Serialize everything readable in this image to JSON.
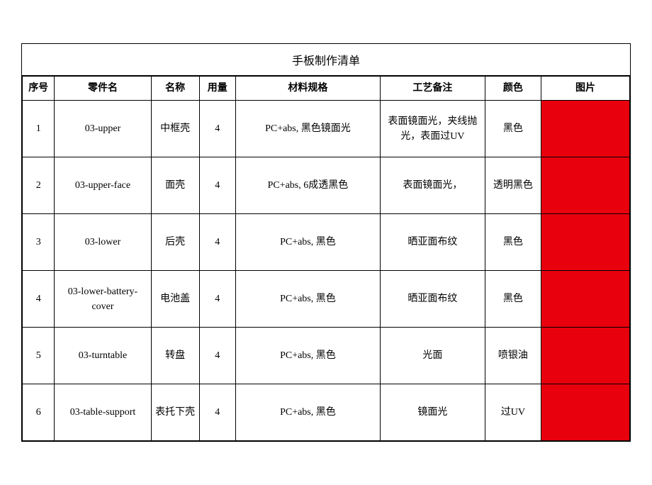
{
  "title": "手板制作清单",
  "headers": {
    "seq": "序号",
    "part_code": "零件名",
    "name": "名称",
    "qty": "用量",
    "spec": "材料规格",
    "craft": "工艺备注",
    "color": "颜色",
    "pic": "图片"
  },
  "rows": [
    {
      "seq": "1",
      "part_code": "03-upper",
      "name": "中框壳",
      "qty": "4",
      "spec": "PC+abs, 黑色镜面光",
      "craft": "表面镜面光，夹线抛光，表面过UV",
      "color": "黑色"
    },
    {
      "seq": "2",
      "part_code": "03-upper-face",
      "name": "面壳",
      "qty": "4",
      "spec": "PC+abs, 6成透黑色",
      "craft": "表面镜面光，",
      "color": "透明黑色"
    },
    {
      "seq": "3",
      "part_code": "03-lower",
      "name": "后壳",
      "qty": "4",
      "spec": "PC+abs, 黑色",
      "craft": "晒亚面布纹",
      "color": "黑色"
    },
    {
      "seq": "4",
      "part_code": "03-lower-battery-cover",
      "name": "电池盖",
      "qty": "4",
      "spec": "PC+abs, 黑色",
      "craft": "晒亚面布纹",
      "color": "黑色"
    },
    {
      "seq": "5",
      "part_code": "03-turntable",
      "name": "转盘",
      "qty": "4",
      "spec": "PC+abs, 黑色",
      "craft": "光面",
      "color": "喷银油"
    },
    {
      "seq": "6",
      "part_code": "03-table-support",
      "name": "表托下壳",
      "qty": "4",
      "spec": "PC+abs, 黑色",
      "craft": "镜面光",
      "color": "过UV"
    }
  ]
}
